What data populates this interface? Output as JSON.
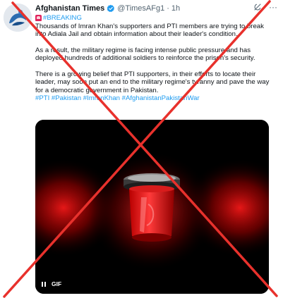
{
  "tweet": {
    "display_name": "Afghanistan Times",
    "handle": "@TimesAFg1",
    "separator": "·",
    "time": "1h",
    "breaking_tag": "#BREAKING",
    "paragraph_1": "Thousands of Imran Khan's supporters and PTI members are trying to break into Adiala Jail and obtain information about their leader's condition.",
    "paragraph_2": "As a result, the military regime is facing intense public pressure and has deployed hundreds of additional soldiers to reinforce the prison's security.",
    "paragraph_3": "There is a growing belief that PTI supporters, in their efforts to locate their leader, may soon put an end to the military regime's tyranny and pave the way for a democratic government in Pakistan.",
    "hashtags": "#PTI #Pakistan #ImranKhan #AfghanistanPakistanWar",
    "more_label": "···"
  },
  "media": {
    "gif_label": "GIF",
    "icon": "siren-light"
  },
  "colors": {
    "link": "#1d9bf0",
    "cross": "#e8312c",
    "verified": "#1d9bf0"
  },
  "overlay": {
    "icon": "red-cross-mark"
  }
}
